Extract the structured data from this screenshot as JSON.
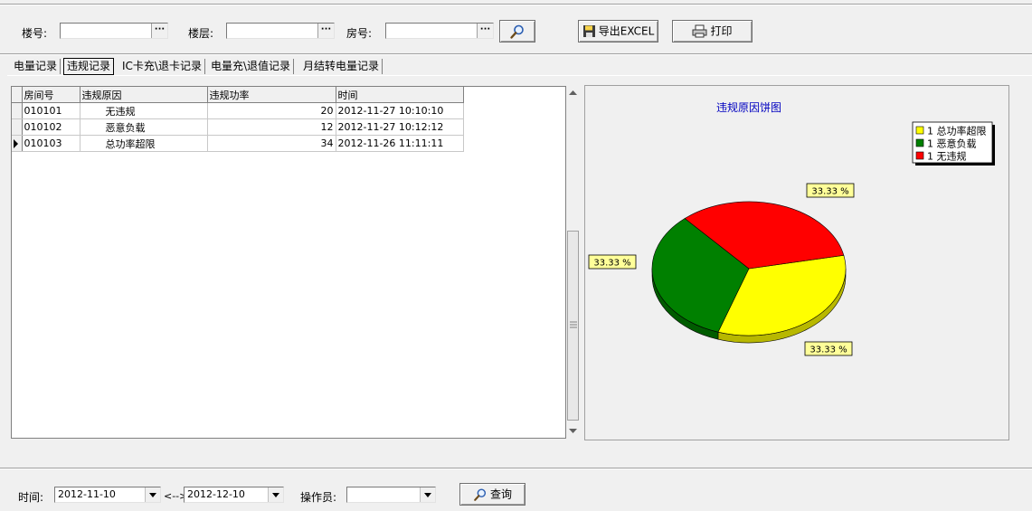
{
  "filters": {
    "building_label": "楼号:",
    "building_value": "",
    "floor_label": "楼层:",
    "floor_value": "",
    "room_label": "房号:",
    "room_value": "",
    "browse_glyph": "···"
  },
  "toolbar": {
    "export_label": "导出EXCEL",
    "print_label": "打印"
  },
  "tabs": [
    {
      "label": "电量记录"
    },
    {
      "label": "违规记录"
    },
    {
      "label": "IC卡充\\退卡记录"
    },
    {
      "label": "电量充\\退值记录"
    },
    {
      "label": "月结转电量记录"
    }
  ],
  "table": {
    "columns": [
      "房间号",
      "违规原因",
      "违规功率",
      "时间"
    ],
    "rows": [
      {
        "room": "010101",
        "reason": "无违规",
        "power": "20",
        "time": "2012-11-27 10:10:10"
      },
      {
        "room": "010102",
        "reason": "恶意负载",
        "power": "12",
        "time": "2012-11-27 10:12:12"
      },
      {
        "room": "010103",
        "reason": "总功率超限",
        "power": "34",
        "time": "2012-11-26 11:11:11"
      }
    ]
  },
  "chart_data": {
    "type": "pie",
    "title": "违规原因饼图",
    "legend_position": "top-right",
    "categories": [
      "总功率超限",
      "恶意负载",
      "无违规"
    ],
    "values": [
      1,
      1,
      1
    ],
    "legend_labels": [
      "1 总功率超限",
      "1 恶意负载",
      "1 无违规"
    ],
    "data_labels": [
      "33.33 %",
      "33.33 %",
      "33.33 %"
    ],
    "colors": [
      "#ffff00",
      "#008000",
      "#ff0000"
    ]
  },
  "bottom": {
    "time_label": "时间:",
    "date_from": "2012-11-10",
    "range_sep": "<-->",
    "date_to": "2012-12-10",
    "operator_label": "操作员:",
    "operator_value": "",
    "query_label": "查询"
  }
}
